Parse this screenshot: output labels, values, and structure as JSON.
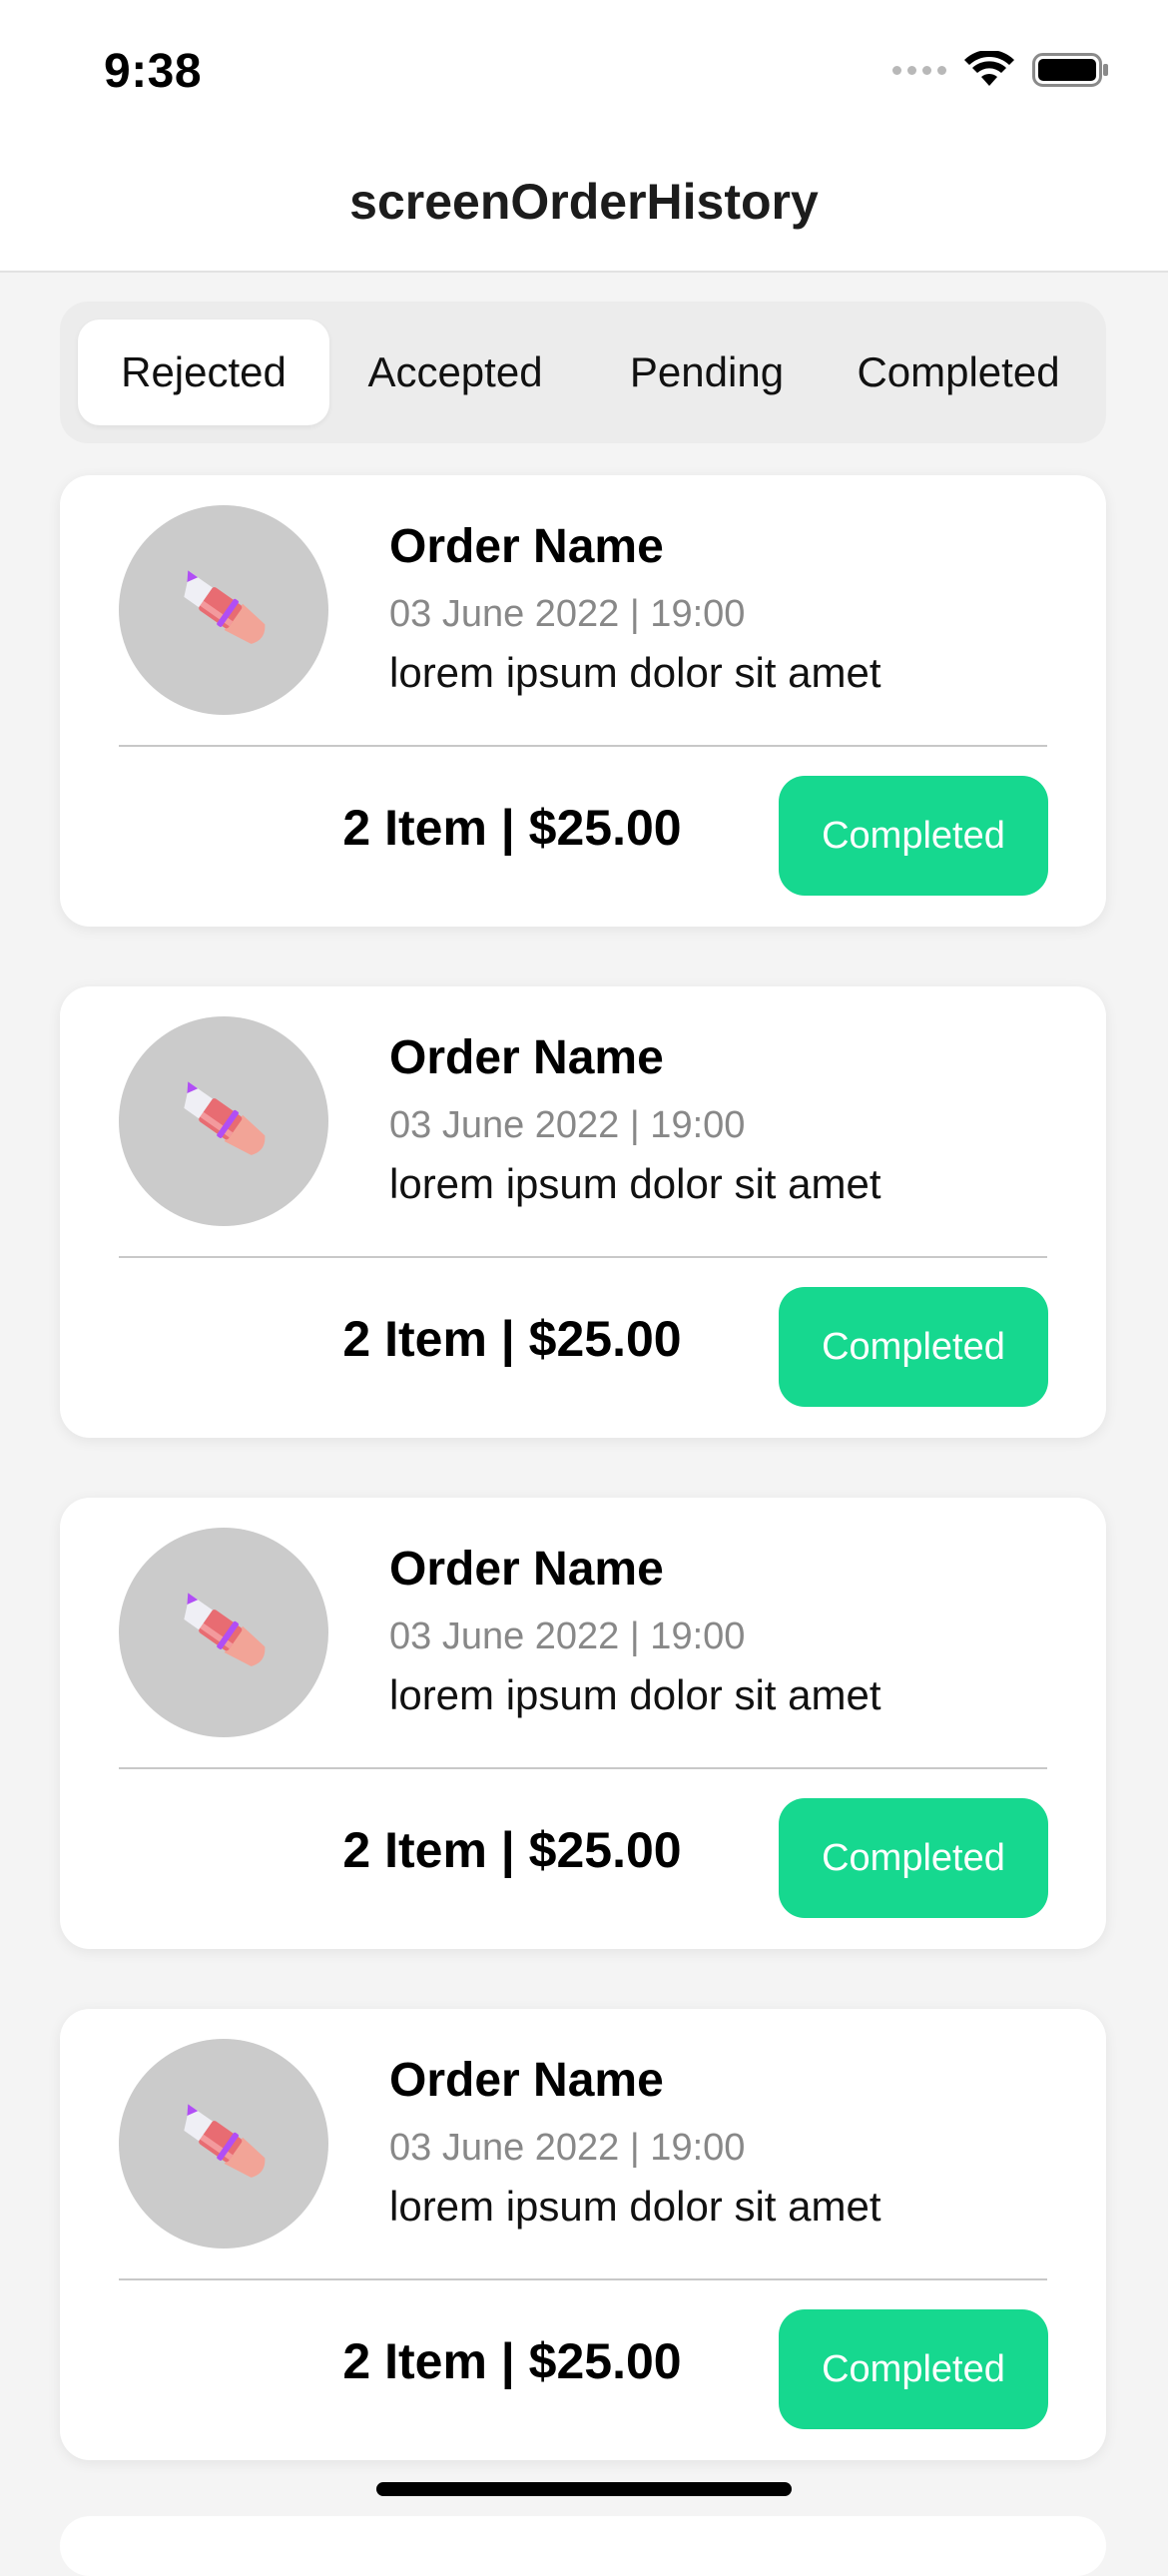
{
  "status_bar": {
    "time": "9:38",
    "icons": [
      "cellular-signal-icon",
      "wifi-icon",
      "battery-icon"
    ]
  },
  "nav": {
    "title": "screenOrderHistory"
  },
  "tabs": [
    {
      "label": "Rejected",
      "selected": true
    },
    {
      "label": "Accepted",
      "selected": false
    },
    {
      "label": "Pending",
      "selected": false
    },
    {
      "label": "Completed",
      "selected": false
    }
  ],
  "orders": [
    {
      "name": "Order Name",
      "date": "03 June 2022 | 19:00",
      "description": "lorem ipsum dolor sit amet",
      "summary": "2 Item | $25.00",
      "status": "Completed",
      "image_icon": "lipstick-icon"
    },
    {
      "name": "Order Name",
      "date": "03 June 2022 | 19:00",
      "description": "lorem ipsum dolor sit amet",
      "summary": "2 Item | $25.00",
      "status": "Completed",
      "image_icon": "lipstick-icon"
    },
    {
      "name": "Order Name",
      "date": "03 June 2022 | 19:00",
      "description": "lorem ipsum dolor sit amet",
      "summary": "2 Item | $25.00",
      "status": "Completed",
      "image_icon": "lipstick-icon"
    },
    {
      "name": "Order Name",
      "date": "03 June 2022 | 19:00",
      "description": "lorem ipsum dolor sit amet",
      "summary": "2 Item | $25.00",
      "status": "Completed",
      "image_icon": "lipstick-icon"
    }
  ],
  "colors": {
    "status_button": "#16d88f",
    "avatar_background": "#cbcbcb",
    "segment_background": "#ececec",
    "page_background": "#f4f4f4"
  }
}
